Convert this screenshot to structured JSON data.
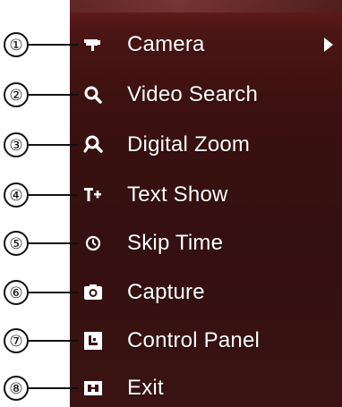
{
  "menu": {
    "items": [
      {
        "number": "①",
        "label": "Camera",
        "icon": "camera-icon",
        "has_submenu": true
      },
      {
        "number": "②",
        "label": "Video Search",
        "icon": "search-icon",
        "has_submenu": false
      },
      {
        "number": "③",
        "label": "Digital Zoom",
        "icon": "zoom-icon",
        "has_submenu": false
      },
      {
        "number": "④",
        "label": "Text Show",
        "icon": "text-show-icon",
        "has_submenu": false
      },
      {
        "number": "⑤",
        "label": "Skip Time",
        "icon": "clock-icon",
        "has_submenu": false
      },
      {
        "number": "⑥",
        "label": "Capture",
        "icon": "capture-icon",
        "has_submenu": false
      },
      {
        "number": "⑦",
        "label": "Control Panel",
        "icon": "control-panel-icon",
        "has_submenu": false
      },
      {
        "number": "⑧",
        "label": "Exit",
        "icon": "exit-icon",
        "has_submenu": false
      }
    ]
  },
  "colors": {
    "panel_background": "#3a1010",
    "text": "#ffffff",
    "callout": "#111111"
  }
}
